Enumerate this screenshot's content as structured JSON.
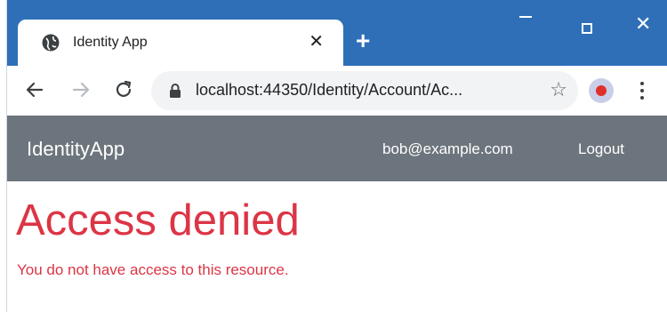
{
  "browser": {
    "tab_title": "Identity App",
    "tab_close": "✕",
    "new_tab": "+",
    "url": "localhost:44350/Identity/Account/Ac...",
    "bookmark_star": "☆",
    "window_controls": {
      "minimize": "minimize-icon",
      "maximize": "maximize-icon",
      "close": "✕"
    }
  },
  "navbar": {
    "brand": "IdentityApp",
    "user": "bob@example.com",
    "logout": "Logout"
  },
  "content": {
    "heading": "Access denied",
    "message": "You do not have access to this resource."
  },
  "colors": {
    "titlebar": "#2f6fb8",
    "navbar": "#6c757d",
    "danger_text": "#dc3545"
  }
}
